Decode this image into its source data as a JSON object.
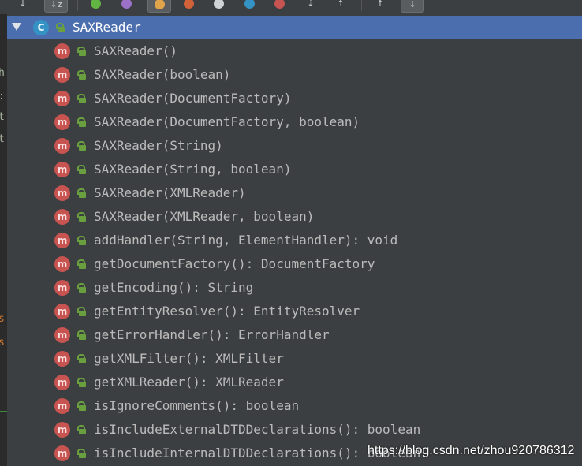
{
  "toolbar": {
    "icons": [
      {
        "name": "sort-by-visibility-icon",
        "glyph": "↓"
      },
      {
        "name": "sort-alphabetically-icon",
        "glyph": "↓z"
      },
      {
        "name": "show-fields-icon",
        "color": "#62b543"
      },
      {
        "name": "show-properties-icon",
        "color": "#9c72c8"
      },
      {
        "name": "show-inherited-icon",
        "color": "#e0a44a"
      },
      {
        "name": "show-anonymous-icon",
        "color": "#d0623a"
      },
      {
        "name": "show-non-public-icon",
        "color": "#cfd3d6"
      },
      {
        "name": "show-lambdas-icon",
        "color": "#3592c4"
      },
      {
        "name": "show-exceptions-icon",
        "color": "#c75450"
      },
      {
        "name": "expand-all-icon",
        "glyph": "⇣"
      },
      {
        "name": "collapse-all-icon",
        "glyph": "⇡"
      },
      {
        "name": "autoscroll-to-source-icon",
        "glyph": "↑"
      },
      {
        "name": "autoscroll-from-source-icon",
        "glyph": "↓"
      }
    ]
  },
  "editor_strip": {
    "chars": [
      {
        "text": "h",
        "color": "#a9b7a0"
      },
      {
        "text": ":",
        "color": "#a9b7a0"
      },
      {
        "text": "t",
        "color": "#a9b7a0"
      },
      {
        "text": "t",
        "color": "#a9b7a0"
      },
      {
        "text": "s",
        "color": "#cc7832"
      },
      {
        "text": "s",
        "color": "#cc7832"
      }
    ]
  },
  "structure": {
    "root": {
      "kind": "C",
      "label": "SAXReader",
      "expanded": true
    },
    "members": [
      {
        "kind": "m",
        "label": "SAXReader()"
      },
      {
        "kind": "m",
        "label": "SAXReader(boolean)"
      },
      {
        "kind": "m",
        "label": "SAXReader(DocumentFactory)"
      },
      {
        "kind": "m",
        "label": "SAXReader(DocumentFactory, boolean)"
      },
      {
        "kind": "m",
        "label": "SAXReader(String)"
      },
      {
        "kind": "m",
        "label": "SAXReader(String, boolean)"
      },
      {
        "kind": "m",
        "label": "SAXReader(XMLReader)"
      },
      {
        "kind": "m",
        "label": "SAXReader(XMLReader, boolean)"
      },
      {
        "kind": "m",
        "label": "addHandler(String, ElementHandler): void"
      },
      {
        "kind": "m",
        "label": "getDocumentFactory(): DocumentFactory"
      },
      {
        "kind": "m",
        "label": "getEncoding(): String"
      },
      {
        "kind": "m",
        "label": "getEntityResolver(): EntityResolver"
      },
      {
        "kind": "m",
        "label": "getErrorHandler(): ErrorHandler"
      },
      {
        "kind": "m",
        "label": "getXMLFilter(): XMLFilter"
      },
      {
        "kind": "m",
        "label": "getXMLReader(): XMLReader"
      },
      {
        "kind": "m",
        "label": "isIgnoreComments(): boolean"
      },
      {
        "kind": "m",
        "label": "isIncludeExternalDTDDeclarations(): boolean"
      },
      {
        "kind": "m",
        "label": "isIncludeInternalDTDDeclarations(): boolean"
      }
    ]
  },
  "watermark": "https://blog.csdn.net/zhou920786312",
  "colors": {
    "background": "#3c3f41",
    "selection": "#4b6eaf",
    "method_badge": "#c75450",
    "class_badge": "#3592c4",
    "public_lock": "#6a9f3f",
    "text": "#bbbbbb"
  }
}
